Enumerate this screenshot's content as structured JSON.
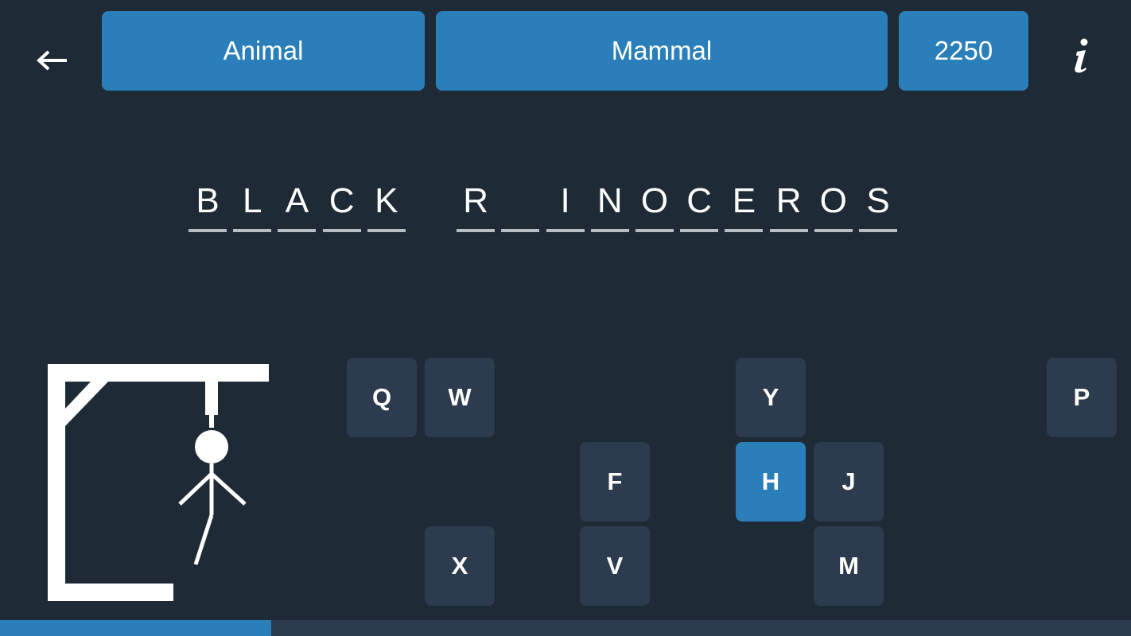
{
  "header": {
    "category": "Animal",
    "subcategory": "Mammal",
    "score": "2250",
    "back_icon": "arrow-left-icon",
    "info_icon": "info-icon"
  },
  "word": {
    "letters": [
      "B",
      "L",
      "A",
      "C",
      "K",
      " ",
      "R",
      "",
      "I",
      "N",
      "O",
      "C",
      "E",
      "R",
      "O",
      "S"
    ]
  },
  "keyboard": {
    "keys": [
      {
        "label": "Q",
        "state": "available"
      },
      {
        "label": "W",
        "state": "available"
      },
      {
        "label": "Y",
        "state": "available"
      },
      {
        "label": "P",
        "state": "available"
      },
      {
        "label": "F",
        "state": "available"
      },
      {
        "label": "H",
        "state": "selected"
      },
      {
        "label": "J",
        "state": "available"
      },
      {
        "label": "X",
        "state": "available"
      },
      {
        "label": "V",
        "state": "available"
      },
      {
        "label": "M",
        "state": "available"
      }
    ]
  },
  "progress": {
    "fraction": 0.24
  },
  "colors": {
    "background": "#1f2a37",
    "accent": "#2a7fbb",
    "key": "#2c3b4d",
    "underline": "#b9bec4"
  }
}
